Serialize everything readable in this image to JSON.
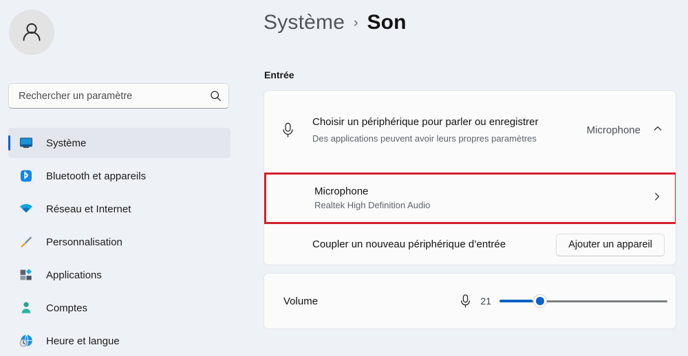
{
  "sidebar": {
    "avatar_icon": "person-avatar-icon",
    "search": {
      "placeholder": "Rechercher un paramètre",
      "value": "",
      "icon": "search-icon"
    },
    "items": [
      {
        "label": "Système",
        "icon": "monitor-icon",
        "selected": true
      },
      {
        "label": "Bluetooth et appareils",
        "icon": "bluetooth-icon",
        "selected": false
      },
      {
        "label": "Réseau et Internet",
        "icon": "wifi-icon",
        "selected": false
      },
      {
        "label": "Personnalisation",
        "icon": "paintbrush-icon",
        "selected": false
      },
      {
        "label": "Applications",
        "icon": "apps-icon",
        "selected": false
      },
      {
        "label": "Comptes",
        "icon": "person-icon",
        "selected": false
      },
      {
        "label": "Heure et langue",
        "icon": "clock-globe-icon",
        "selected": false
      }
    ]
  },
  "header": {
    "breadcrumb_parent": "Système",
    "breadcrumb_separator": "›",
    "breadcrumb_current": "Son"
  },
  "main": {
    "section_label": "Entrée",
    "choose_device": {
      "icon": "microphone-icon",
      "title": "Choisir un périphérique pour parler ou enregistrer",
      "subtitle": "Des applications peuvent avoir leurs propres paramètres",
      "value": "Microphone",
      "expand_icon": "chevron-up-icon"
    },
    "microphone_row": {
      "title": "Microphone",
      "subtitle": "Realtek High Definition Audio",
      "chevron_icon": "chevron-right-icon",
      "highlight_color": "#d4202f"
    },
    "pair_device": {
      "title": "Coupler un nouveau périphérique d’entrée",
      "button_label": "Ajouter un appareil"
    },
    "volume": {
      "label": "Volume",
      "icon": "microphone-icon",
      "value": "21",
      "min": 0,
      "max": 100,
      "percent": 24,
      "fill_color": "#0d62c4",
      "track_color": "#7b7d80"
    }
  }
}
